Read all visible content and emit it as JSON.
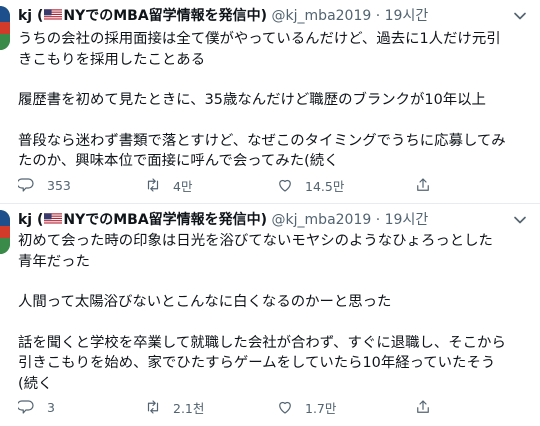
{
  "tweets": [
    {
      "author": {
        "name_prefix": "kj (",
        "name_suffix": "NYでのMBA留学情報を発信中)",
        "handle": "@kj_mba2019",
        "flag_icon": "us-flag-icon"
      },
      "separator": "·",
      "time": "19시간",
      "paragraphs": [
        [
          "うちの会社の採用面接は全て僕がやっているんだけど、過去に1人だけ元引",
          "きこもりを採用したことある"
        ],
        [
          "履歴書を初めて見たときに、35歳なんだけど職歴のブランクが10年以上"
        ],
        [
          "普段なら迷わず書類で落とすけど、なぜこのタイミングでうちに応募してみ",
          "たのか、興味本位で面接に呼んで会ってみた(続く"
        ]
      ],
      "stats": {
        "replies": "353",
        "retweets": "4만",
        "likes": "14.5만"
      }
    },
    {
      "author": {
        "name_prefix": "kj (",
        "name_suffix": "NYでのMBA留学情報を発信中)",
        "handle": "@kj_mba2019",
        "flag_icon": "us-flag-icon"
      },
      "separator": "·",
      "time": "19시간",
      "paragraphs": [
        [
          "初めて会った時の印象は日光を浴びてないモヤシのようなひょろっとした",
          "青年だった"
        ],
        [
          "人間って太陽浴びないとこんなに白くなるのかーと思った"
        ],
        [
          "話を聞くと学校を卒業して就職した会社が合わず、すぐに退職し、そこから",
          "引きこもりを始め、家でひたすらゲームをしていたら10年経っていたそう",
          "(続く"
        ]
      ],
      "stats": {
        "replies": "3",
        "retweets": "2.1천",
        "likes": "1.7만"
      }
    }
  ],
  "icons": {
    "reply": "reply-icon",
    "retweet": "retweet-icon",
    "like": "heart-icon",
    "share": "share-icon",
    "more": "chevron-down-icon"
  },
  "colors": {
    "text": "#0f1419",
    "secondary": "#536471",
    "divider": "#e6ecf0"
  }
}
